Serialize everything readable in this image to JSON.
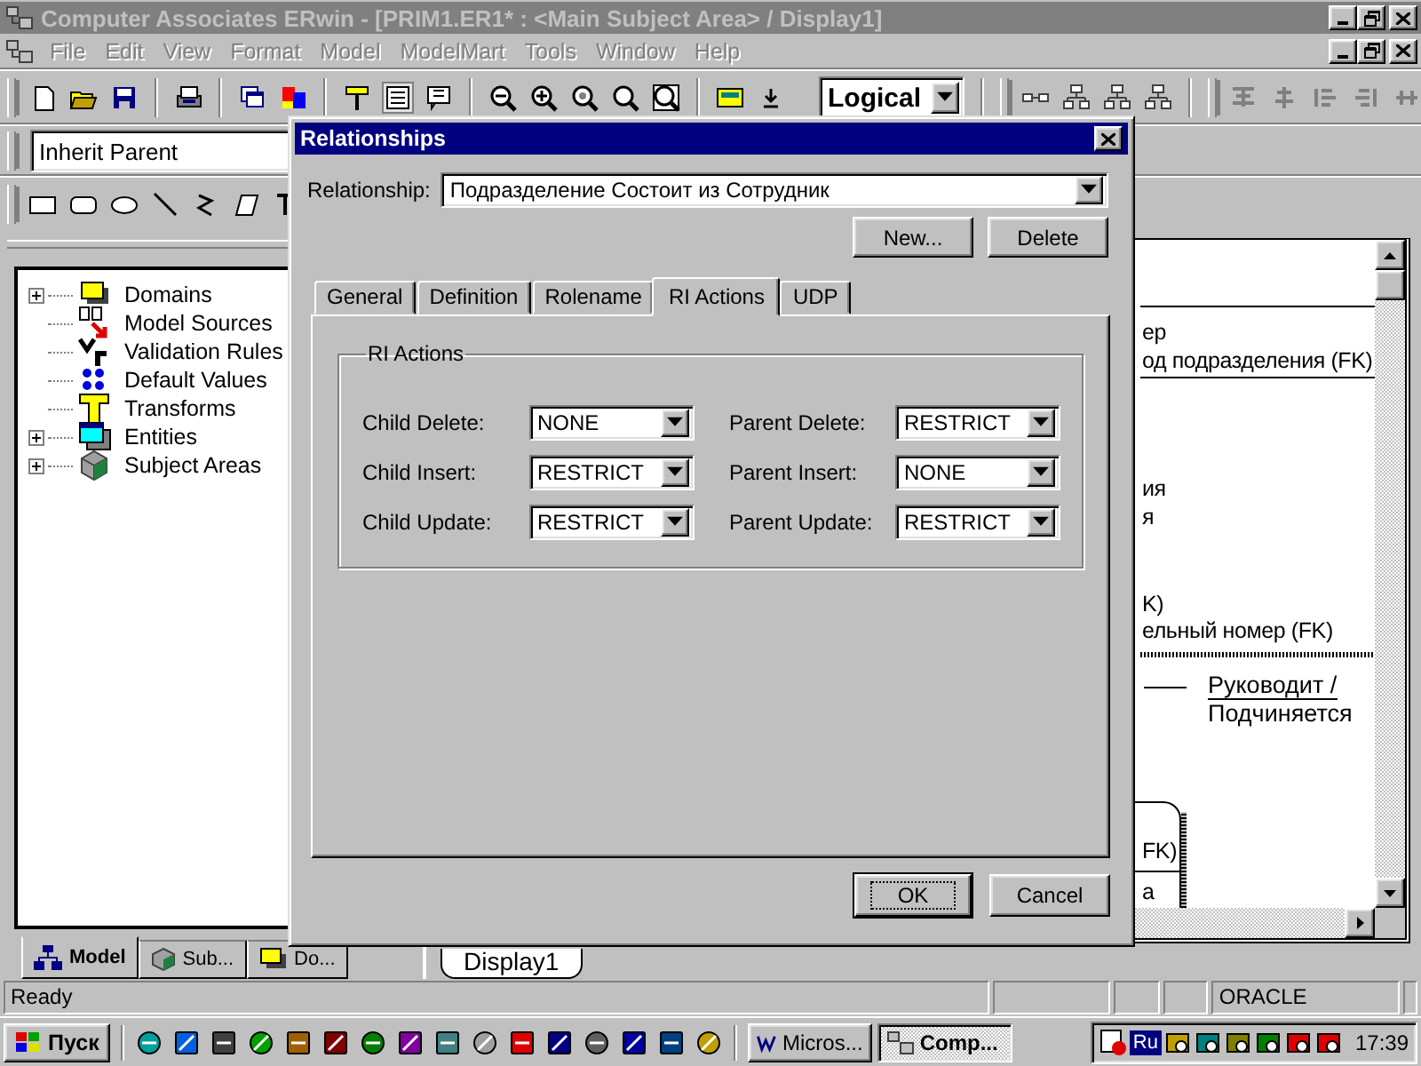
{
  "window": {
    "title": "Computer Associates ERwin - [PRIM1.ER1* : <Main Subject Area> / Display1]"
  },
  "menu": [
    "File",
    "Edit",
    "View",
    "Format",
    "Model",
    "ModelMart",
    "Tools",
    "Window",
    "Help"
  ],
  "toolbar": {
    "display_level": "Logical"
  },
  "inherit_combo": {
    "value": "Inherit Parent"
  },
  "model_tree": [
    {
      "label": "Domains",
      "expandable": true
    },
    {
      "label": "Model Sources",
      "expandable": false
    },
    {
      "label": "Validation Rules",
      "expandable": false
    },
    {
      "label": "Default Values",
      "expandable": false
    },
    {
      "label": "Transforms",
      "expandable": false
    },
    {
      "label": "Entities",
      "expandable": true
    },
    {
      "label": "Subject Areas",
      "expandable": true
    }
  ],
  "panel_tabs": [
    {
      "label": "Model",
      "selected": true
    },
    {
      "label": "Sub...",
      "selected": false
    },
    {
      "label": "Do...",
      "selected": false
    }
  ],
  "diagram": {
    "texts": [
      "ер",
      "од подразделения (FK)",
      "ия",
      "я",
      "K)",
      "ельный номер (FK)",
      "FK)",
      "а"
    ],
    "relationship_label": [
      "Руководит /",
      "Подчиняется"
    ],
    "tab": "Display1"
  },
  "dialog": {
    "title": "Relationships",
    "relationship_label": "Relationship:",
    "relationship": "Подразделение Состоит из Сотрудник",
    "buttons": [
      "New...",
      "Delete"
    ],
    "tabs": [
      {
        "label": "General",
        "selected": false
      },
      {
        "label": "Definition",
        "selected": false
      },
      {
        "label": "Rolename",
        "selected": false
      },
      {
        "label": "RI Actions",
        "selected": true
      },
      {
        "label": "UDP",
        "selected": false
      }
    ],
    "group_title": "RI Actions",
    "fields": [
      {
        "label": "Child Delete:",
        "value": "NONE"
      },
      {
        "label": "Parent Delete:",
        "value": "RESTRICT"
      },
      {
        "label": "Child Insert:",
        "value": "RESTRICT"
      },
      {
        "label": "Parent Insert:",
        "value": "NONE"
      },
      {
        "label": "Child Update:",
        "value": "RESTRICT"
      },
      {
        "label": "Parent Update:",
        "value": "RESTRICT"
      }
    ],
    "footer_buttons": [
      {
        "label": "OK",
        "default": true
      },
      {
        "label": "Cancel",
        "default": false
      }
    ]
  },
  "status_bar": {
    "text": "Ready",
    "database": "ORACLE"
  },
  "taskbar": {
    "start": "Пуск",
    "tasks": [
      {
        "label": "Micros...",
        "selected": false
      },
      {
        "label": "Comp...",
        "selected": true
      }
    ],
    "language": "Ru",
    "clock": "17:39"
  }
}
